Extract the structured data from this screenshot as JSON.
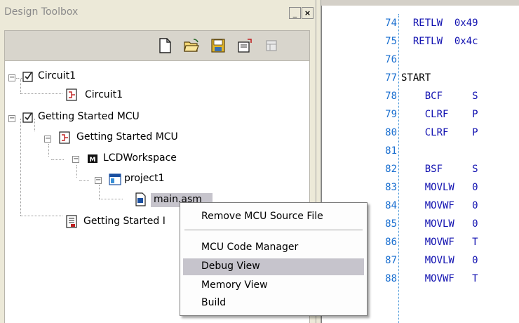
{
  "panel": {
    "title": "Design Toolbox",
    "minimize_glyph": "_",
    "close_glyph": "×"
  },
  "toolbar": {
    "icons": [
      "new-file-icon",
      "open-folder-icon",
      "save-icon",
      "export-icon",
      "layout-icon"
    ]
  },
  "tree": {
    "nodes": [
      {
        "label": "Circuit1",
        "icon": "checkbox-icon"
      },
      {
        "label": "Circuit1",
        "icon": "circuit-icon"
      },
      {
        "label": "Getting Started MCU",
        "icon": "checkbox-icon"
      },
      {
        "label": "Getting Started MCU",
        "icon": "circuit-icon"
      },
      {
        "label": "LCDWorkspace",
        "icon": "workspace-icon"
      },
      {
        "label": "project1",
        "icon": "project-icon"
      },
      {
        "label": "main.asm",
        "icon": "asm-file-icon"
      },
      {
        "label": "Getting Started I",
        "icon": "report-icon"
      }
    ],
    "expander_minus": "−"
  },
  "context_menu": {
    "items": [
      "Remove MCU Source File",
      "MCU Code Manager",
      "Debug View",
      "Memory View",
      "Build"
    ],
    "highlighted": "Debug View"
  },
  "code": {
    "lines": [
      {
        "num": "74",
        "text": "  RETLW  0x49"
      },
      {
        "num": "75",
        "text": "  RETLW  0x4c"
      },
      {
        "num": "76",
        "text": ""
      },
      {
        "num": "77",
        "text": "START"
      },
      {
        "num": "78",
        "text": "    BCF     S"
      },
      {
        "num": "79",
        "text": "    CLRF    P"
      },
      {
        "num": "80",
        "text": "    CLRF    P"
      },
      {
        "num": "81",
        "text": ""
      },
      {
        "num": "82",
        "text": "    BSF     S"
      },
      {
        "num": "83",
        "text": "    MOVLW   0"
      },
      {
        "num": "84",
        "text": "    MOVWF   0"
      },
      {
        "num": "85",
        "text": "    MOVLW   0"
      },
      {
        "num": "86",
        "text": "    MOVWF   T"
      },
      {
        "num": "87",
        "text": "    MOVLW   0"
      },
      {
        "num": "88",
        "text": "    MOVWF   T"
      }
    ]
  },
  "colors": {
    "line_number": "#1a6fd0",
    "menu_highlight": "#c6c4cc"
  }
}
